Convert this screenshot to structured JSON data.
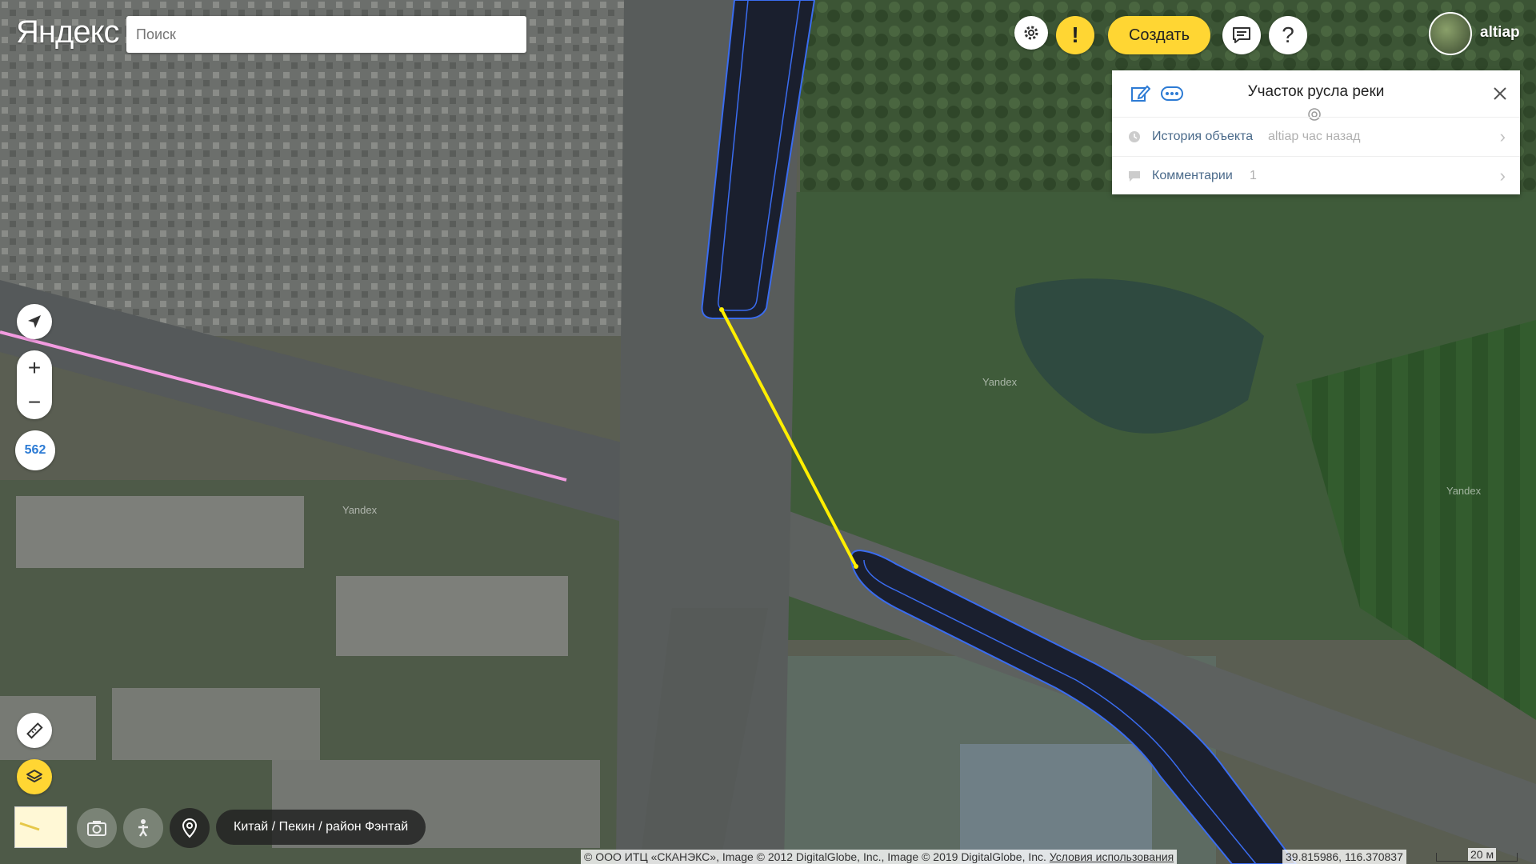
{
  "header": {
    "logo": "Яндекс",
    "search_placeholder": "Поиск",
    "create_label": "Создать",
    "username": "altiap"
  },
  "panel": {
    "title": "Участок русла реки",
    "history_label": "История объекта",
    "history_value": "altiap час назад",
    "comments_label": "Комментарии",
    "comments_value": "1"
  },
  "map": {
    "zoom_level": "562",
    "breadcrumb": "Китай / Пекин / район Фэнтай",
    "watermark": "Yandex",
    "coords": "39.815986, 116.370837",
    "scale": "20 м",
    "attribution": "© ООО ИТЦ «СКАНЭКС», Image © 2012 DigitalGlobe, Inc., Image © 2019 DigitalGlobe, Inc.",
    "terms_link": "Условия использования",
    "colors": {
      "river": "#1a1f2e",
      "river_outline": "#3a6cf0",
      "selected_segment": "#ffee00",
      "pink_line": "#f29be0",
      "accent": "#ffd633"
    }
  }
}
